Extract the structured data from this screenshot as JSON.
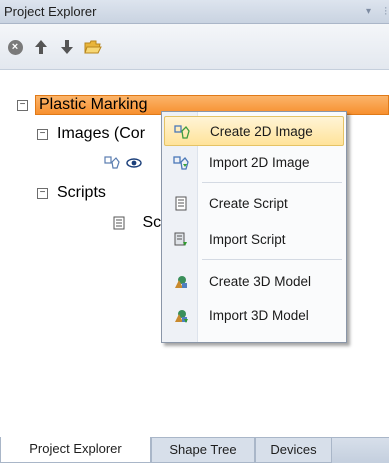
{
  "window": {
    "title": "Project Explorer",
    "pin_glyph": "▾",
    "menu_glyph": "⫶"
  },
  "toolbar": {
    "buttons": [
      {
        "icon": "cancel-icon",
        "glyph": "×"
      },
      {
        "icon": "arrow-up-icon",
        "glyph": "🡅"
      },
      {
        "icon": "arrow-down-icon",
        "glyph": "🡇"
      },
      {
        "icon": "folder-open-icon",
        "glyph": "📂"
      }
    ]
  },
  "tree": {
    "root": {
      "label": "Plastic Marking",
      "expander": "−"
    },
    "images": {
      "label": "Images (Cor",
      "expander": "−"
    },
    "scripts": {
      "label": "Scripts",
      "expander": "−"
    },
    "script_item": {
      "label": "Sc"
    }
  },
  "context_menu": {
    "items": [
      {
        "label": "Create 2D Image",
        "icon": "shape-2d-icon",
        "glyph": "⬠"
      },
      {
        "label": "Import 2D Image",
        "icon": "import-2d-icon",
        "glyph": "⬠"
      },
      {
        "label": "Create Script",
        "icon": "script-icon",
        "glyph": "▤"
      },
      {
        "label": "Import Script",
        "icon": "import-script-icon",
        "glyph": "▤"
      },
      {
        "label": "Create 3D Model",
        "icon": "model-3d-icon",
        "glyph": "◆"
      },
      {
        "label": "Import 3D Model",
        "icon": "import-3d-icon",
        "glyph": "◆"
      }
    ]
  },
  "tabs": [
    {
      "label": "Project Explorer",
      "active": true
    },
    {
      "label": "Shape Tree",
      "active": false
    },
    {
      "label": "Devices",
      "active": false
    }
  ],
  "colors": {
    "selection": "#f7902f",
    "menu_hover": "#ffe39a",
    "accent_blue": "#2d6fc0"
  }
}
